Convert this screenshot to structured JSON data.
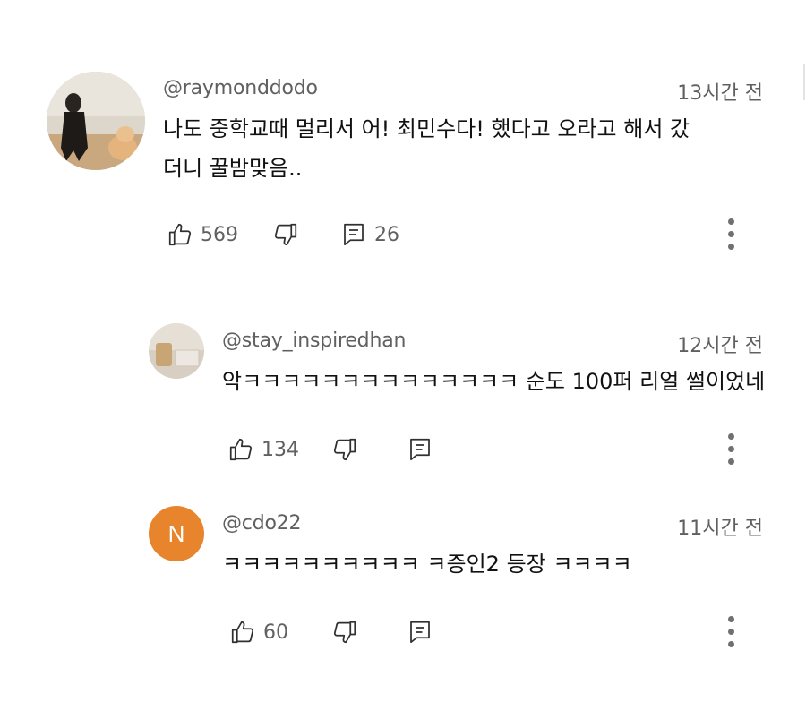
{
  "comments": [
    {
      "handle": "@raymonddodo",
      "time": "13시간 전",
      "text_line1": "나도 중학교때 멀리서 어! 최민수다! 했다고 오라고 해서 갔",
      "text_line2": "더니 꿀밤맞음..",
      "likes": "569",
      "replies": "26",
      "avatar_type": "photo"
    },
    {
      "handle": "@stay_inspiredhan",
      "time": "12시간 전",
      "text": "악ㅋㅋㅋㅋㅋㅋㅋㅋㅋㅋㅋㅋㅋㅋ 순도 100퍼 리얼 썰이었네",
      "likes": "134",
      "avatar_type": "photo"
    },
    {
      "handle": "@cdo22",
      "time": "11시간 전",
      "text": "ㅋㅋㅋㅋㅋㅋㅋㅋㅋㅋ ㅋ증인2 등장 ㅋㅋㅋㅋ",
      "likes": "60",
      "avatar_letter": "N",
      "avatar_color": "#e8852c"
    }
  ],
  "icons": {
    "like": "thumbs-up-icon",
    "dislike": "thumbs-down-icon",
    "reply": "comment-icon",
    "more": "more-vertical-icon"
  }
}
